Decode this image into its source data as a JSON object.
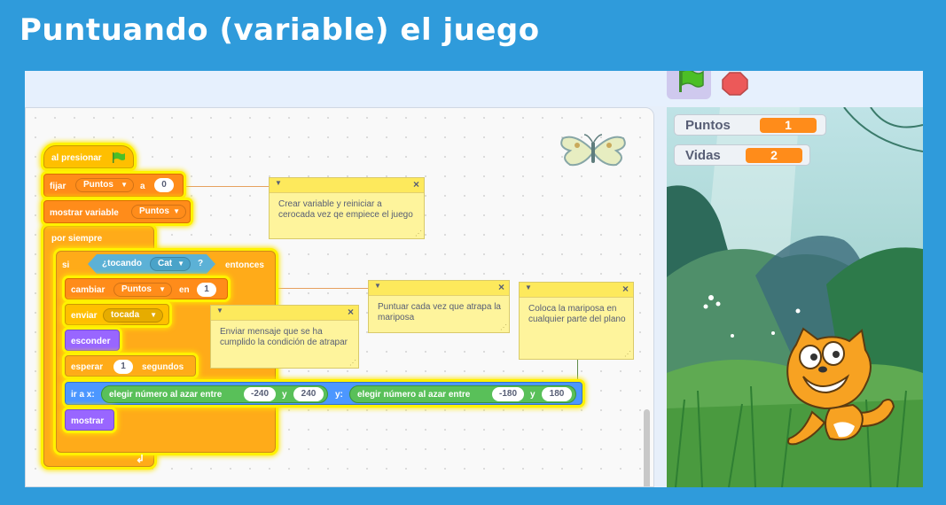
{
  "slide": {
    "title": "Puntuando (variable) el juego"
  },
  "stage": {
    "monitors": [
      {
        "label": "Puntos",
        "value": "1"
      },
      {
        "label": "Vidas",
        "value": "2"
      }
    ]
  },
  "script": {
    "hat": {
      "text": "al presionar"
    },
    "set_var": {
      "prefix": "fijar",
      "var": "Puntos",
      "mid": "a",
      "value": "0"
    },
    "show_var": {
      "prefix": "mostrar variable",
      "var": "Puntos"
    },
    "forever": {
      "label": "por siempre"
    },
    "if_block": {
      "if": "si",
      "then": "entonces"
    },
    "touching": {
      "label": "¿tocando",
      "target": "Cat",
      "q": "?"
    },
    "change_var": {
      "prefix": "cambiar",
      "var": "Puntos",
      "mid": "en",
      "value": "1"
    },
    "broadcast": {
      "prefix": "enviar",
      "message": "tocada"
    },
    "hide": {
      "label": "esconder"
    },
    "wait": {
      "prefix": "esperar",
      "value": "1",
      "suffix": "segundos"
    },
    "goto": {
      "prefix": "ir a x:",
      "rand1_label": "elegir número al azar entre",
      "x_min": "-240",
      "y1": "y",
      "x_max": "240",
      "y_label": "y:",
      "rand2_label": "elegir número al azar entre",
      "y_min": "-180",
      "y2": "y",
      "y_max": "180"
    },
    "show": {
      "label": "mostrar"
    }
  },
  "comments": {
    "c1": "Crear variable y reiniciar a cerocada vez qe empiece el juego",
    "c2": "Enviar mensaje que se ha cumplido la condición de atrapar",
    "c3": "Puntuar cada vez que atrapa la mariposa",
    "c4": "Coloca la mariposa en cualquier parte del plano"
  },
  "icons": {
    "flag": "green-flag-icon",
    "stop": "stop-icon",
    "sprite_thumb": "butterfly-icon",
    "loop_arrow": "loop-arrow-icon"
  },
  "colors": {
    "background": "#2f9bdb",
    "events": "#ffbf00",
    "variables": "#ff8c1a",
    "control": "#ffab19",
    "sensing": "#5cb1d6",
    "operators": "#59c059",
    "motion": "#4c97ff",
    "looks": "#9966ff",
    "comment": "#fef49c"
  }
}
